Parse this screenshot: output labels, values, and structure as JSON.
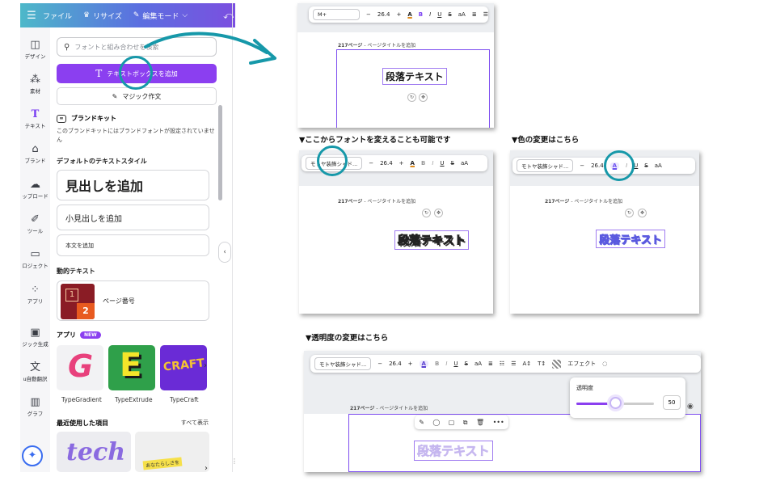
{
  "topbar": {
    "menu_icon": "hamburger-icon",
    "file": "ファイル",
    "resize": "リサイズ",
    "edit_mode": "編集モード"
  },
  "rail": {
    "items": [
      {
        "label": "デザイン",
        "icon": "design-icon"
      },
      {
        "label": "素材",
        "icon": "elements-icon"
      },
      {
        "label": "テキスト",
        "icon": "text-icon"
      },
      {
        "label": "ブランド",
        "icon": "brand-icon"
      },
      {
        "label": "ップロード",
        "icon": "upload-icon"
      },
      {
        "label": "ツール",
        "icon": "tools-icon"
      },
      {
        "label": "ロジェクト",
        "icon": "folder-icon"
      },
      {
        "label": "アプリ",
        "icon": "apps-icon"
      },
      {
        "label": "ジック生成",
        "icon": "magic-media-icon"
      },
      {
        "label": "u自動翻訳",
        "icon": "translate-icon"
      },
      {
        "label": "グラフ",
        "icon": "chart-icon"
      }
    ]
  },
  "panel": {
    "search_placeholder": "フォントと組み合わせを検索",
    "add_textbox": "テキストボックスを追加",
    "magic_write": "マジック作文",
    "brand_kit_title": "ブランドキット",
    "brand_kit_desc": "このブランドキットにはブランドフォントが設定されていません",
    "default_styles_title": "デフォルトのテキストスタイル",
    "heading": "見出しを追加",
    "subheading": "小見出しを追加",
    "body": "本文を追加",
    "dynamic_title": "動的テキスト",
    "page_number": "ページ番号",
    "page_number_thumb_1": "1",
    "page_number_thumb_2": "2",
    "apps_title": "アプリ",
    "new_badge": "NEW",
    "apps": [
      {
        "name": "TypeGradient",
        "glyph": "G"
      },
      {
        "name": "TypeExtrude",
        "glyph": "E"
      },
      {
        "name": "TypeCraft",
        "glyph": "CRAFT"
      }
    ],
    "recent_title": "最近使用した項目",
    "see_all": "すべて表示",
    "recent_tech": "tech",
    "recent_sticker": "あなたらしさを"
  },
  "shot1": {
    "font": "M+",
    "size": "26.4",
    "page_label_num": "217ページ",
    "page_label_title": " - ページタイトルを追加",
    "sample_text": "段落テキスト"
  },
  "captions": {
    "font_change": "▼ここからフォントを変えることも可能です",
    "color_change": "▼色の変更はこちら",
    "transparency_change": "▼透明度の変更はこちら"
  },
  "shot2": {
    "font": "モトヤ装飾シャド...",
    "size": "26.4",
    "page_label_num": "217ページ",
    "page_label_title": " - ページタイトルを追加",
    "sample_text": "段落テキスト"
  },
  "shot3": {
    "font": "モトヤ装飾シャド...",
    "size": "26.4",
    "page_label_num": "217ページ",
    "page_label_title": " - ページタイトルを追加",
    "sample_text": "段落テキスト"
  },
  "shot4": {
    "font": "モトヤ装飾シャド...",
    "size": "26.4",
    "effects": "エフェクト",
    "page_label_num": "217ページ",
    "page_label_title": " - ページタイトルを追加",
    "sample_text": "段落テキスト",
    "transparency_label": "透明度",
    "transparency_value": "50",
    "transparency_fraction": 0.5
  },
  "colors": {
    "accent_purple": "#8b3ff0",
    "highlight_teal": "#1698a9",
    "text_purple_light": "#b59cf0"
  }
}
